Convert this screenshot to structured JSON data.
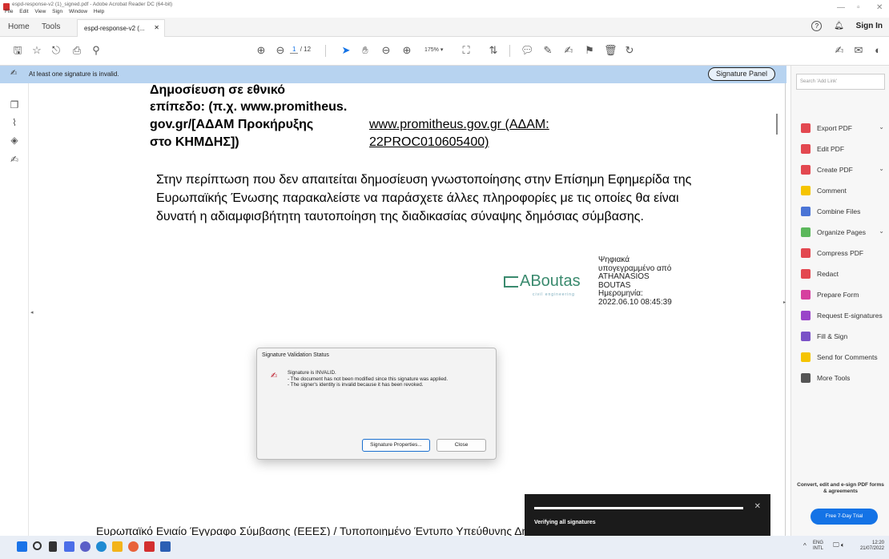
{
  "window": {
    "title": "espd-response-v2 (1)_signed.pdf - Adobe Acrobat Reader DC (64-bit)",
    "menus": [
      "File",
      "Edit",
      "View",
      "Sign",
      "Window",
      "Help"
    ]
  },
  "tabs": {
    "home": "Home",
    "tools": "Tools",
    "doc_tab": "espd-response-v2 (...",
    "sign_in": "Sign In"
  },
  "toolbar": {
    "page_current": "1",
    "page_total": "/ 12",
    "zoom": "175%"
  },
  "signature_bar": {
    "message": "At least one signature is invalid.",
    "panel_button": "Signature Panel"
  },
  "document": {
    "row1_left_line1": "Δημοσίευση σε εθνικό",
    "row1_left_line2": "επίπεδο: (π.χ. www.promitheus.",
    "row1_left_line3": "gov.gr/[ΑΔΑΜ Προκήρυξης",
    "row1_left_line4": "στο ΚΗΜΔΗΣ])",
    "row1_right_line1": "www.promitheus.gov.gr (ΑΔΑΜ:",
    "row1_right_line2": "22PROC010605400)",
    "paragraph": "Στην περίπτωση που δεν απαιτείται δημοσίευση γνωστοποίησης στην Επίσημη Εφημερίδα της Ευρωπαϊκής Ένωσης παρακαλείστε να παράσχετε άλλες πληροφορίες με τις οποίες θα είναι δυνατή η αδιαμφισβήτητη ταυτοποίηση της διαδικασίας σύναψης δημόσιας σύμβασης.",
    "stamp_logo": "ABoutas",
    "stamp_logo_sub": "civil engineering",
    "stamp_lines": [
      "Ψηφιακά",
      "υπογεγραμμένο από",
      "ATHANASIOS",
      "BOUTAS",
      "Ημερομηνία:",
      "2022.06.10 08:45:39"
    ],
    "footer": "Ευρωπαϊκό Ενιαίο Έγγραφο Σύμβασης (ΕΕΕΣ) / Τυποποιημένο Έντυπο Υπεύθυνης Δήλωσης (ΤΕΥΔ)"
  },
  "dialog": {
    "title": "Signature Validation Status",
    "lines": [
      "Signature is INVALID.",
      "- The document has not been modified since this signature was applied.",
      "- The signer's identity is invalid because it has been revoked."
    ],
    "btn_properties": "Signature Properties...",
    "btn_close": "Close"
  },
  "verify": {
    "text": "Verifying all signatures",
    "progress": 1.0
  },
  "right_panel": {
    "search_placeholder": "Search 'Add Link'",
    "tools": [
      {
        "label": "Export PDF",
        "color": "#e34850",
        "chevron": true
      },
      {
        "label": "Edit PDF",
        "color": "#e34850",
        "chevron": false
      },
      {
        "label": "Create PDF",
        "color": "#e34850",
        "chevron": true
      },
      {
        "label": "Comment",
        "color": "#f5c400",
        "chevron": false
      },
      {
        "label": "Combine Files",
        "color": "#4b75d6",
        "chevron": false
      },
      {
        "label": "Organize Pages",
        "color": "#5cb85c",
        "chevron": true
      },
      {
        "label": "Compress PDF",
        "color": "#e34850",
        "chevron": false
      },
      {
        "label": "Redact",
        "color": "#e34850",
        "chevron": false
      },
      {
        "label": "Prepare Form",
        "color": "#d6409f",
        "chevron": false
      },
      {
        "label": "Request E-signatures",
        "color": "#9a44c9",
        "chevron": false
      },
      {
        "label": "Fill & Sign",
        "color": "#7a52c7",
        "chevron": false
      },
      {
        "label": "Send for Comments",
        "color": "#f5c400",
        "chevron": false
      },
      {
        "label": "More Tools",
        "color": "#555555",
        "chevron": false
      }
    ],
    "promo": "Convert, edit and e-sign PDF forms & agreements",
    "trial_button": "Free 7-Day Trial"
  },
  "taskbar": {
    "lang_top": "ENG",
    "lang_bottom": "INTL",
    "time": "12:20",
    "date": "21/07/2022"
  }
}
